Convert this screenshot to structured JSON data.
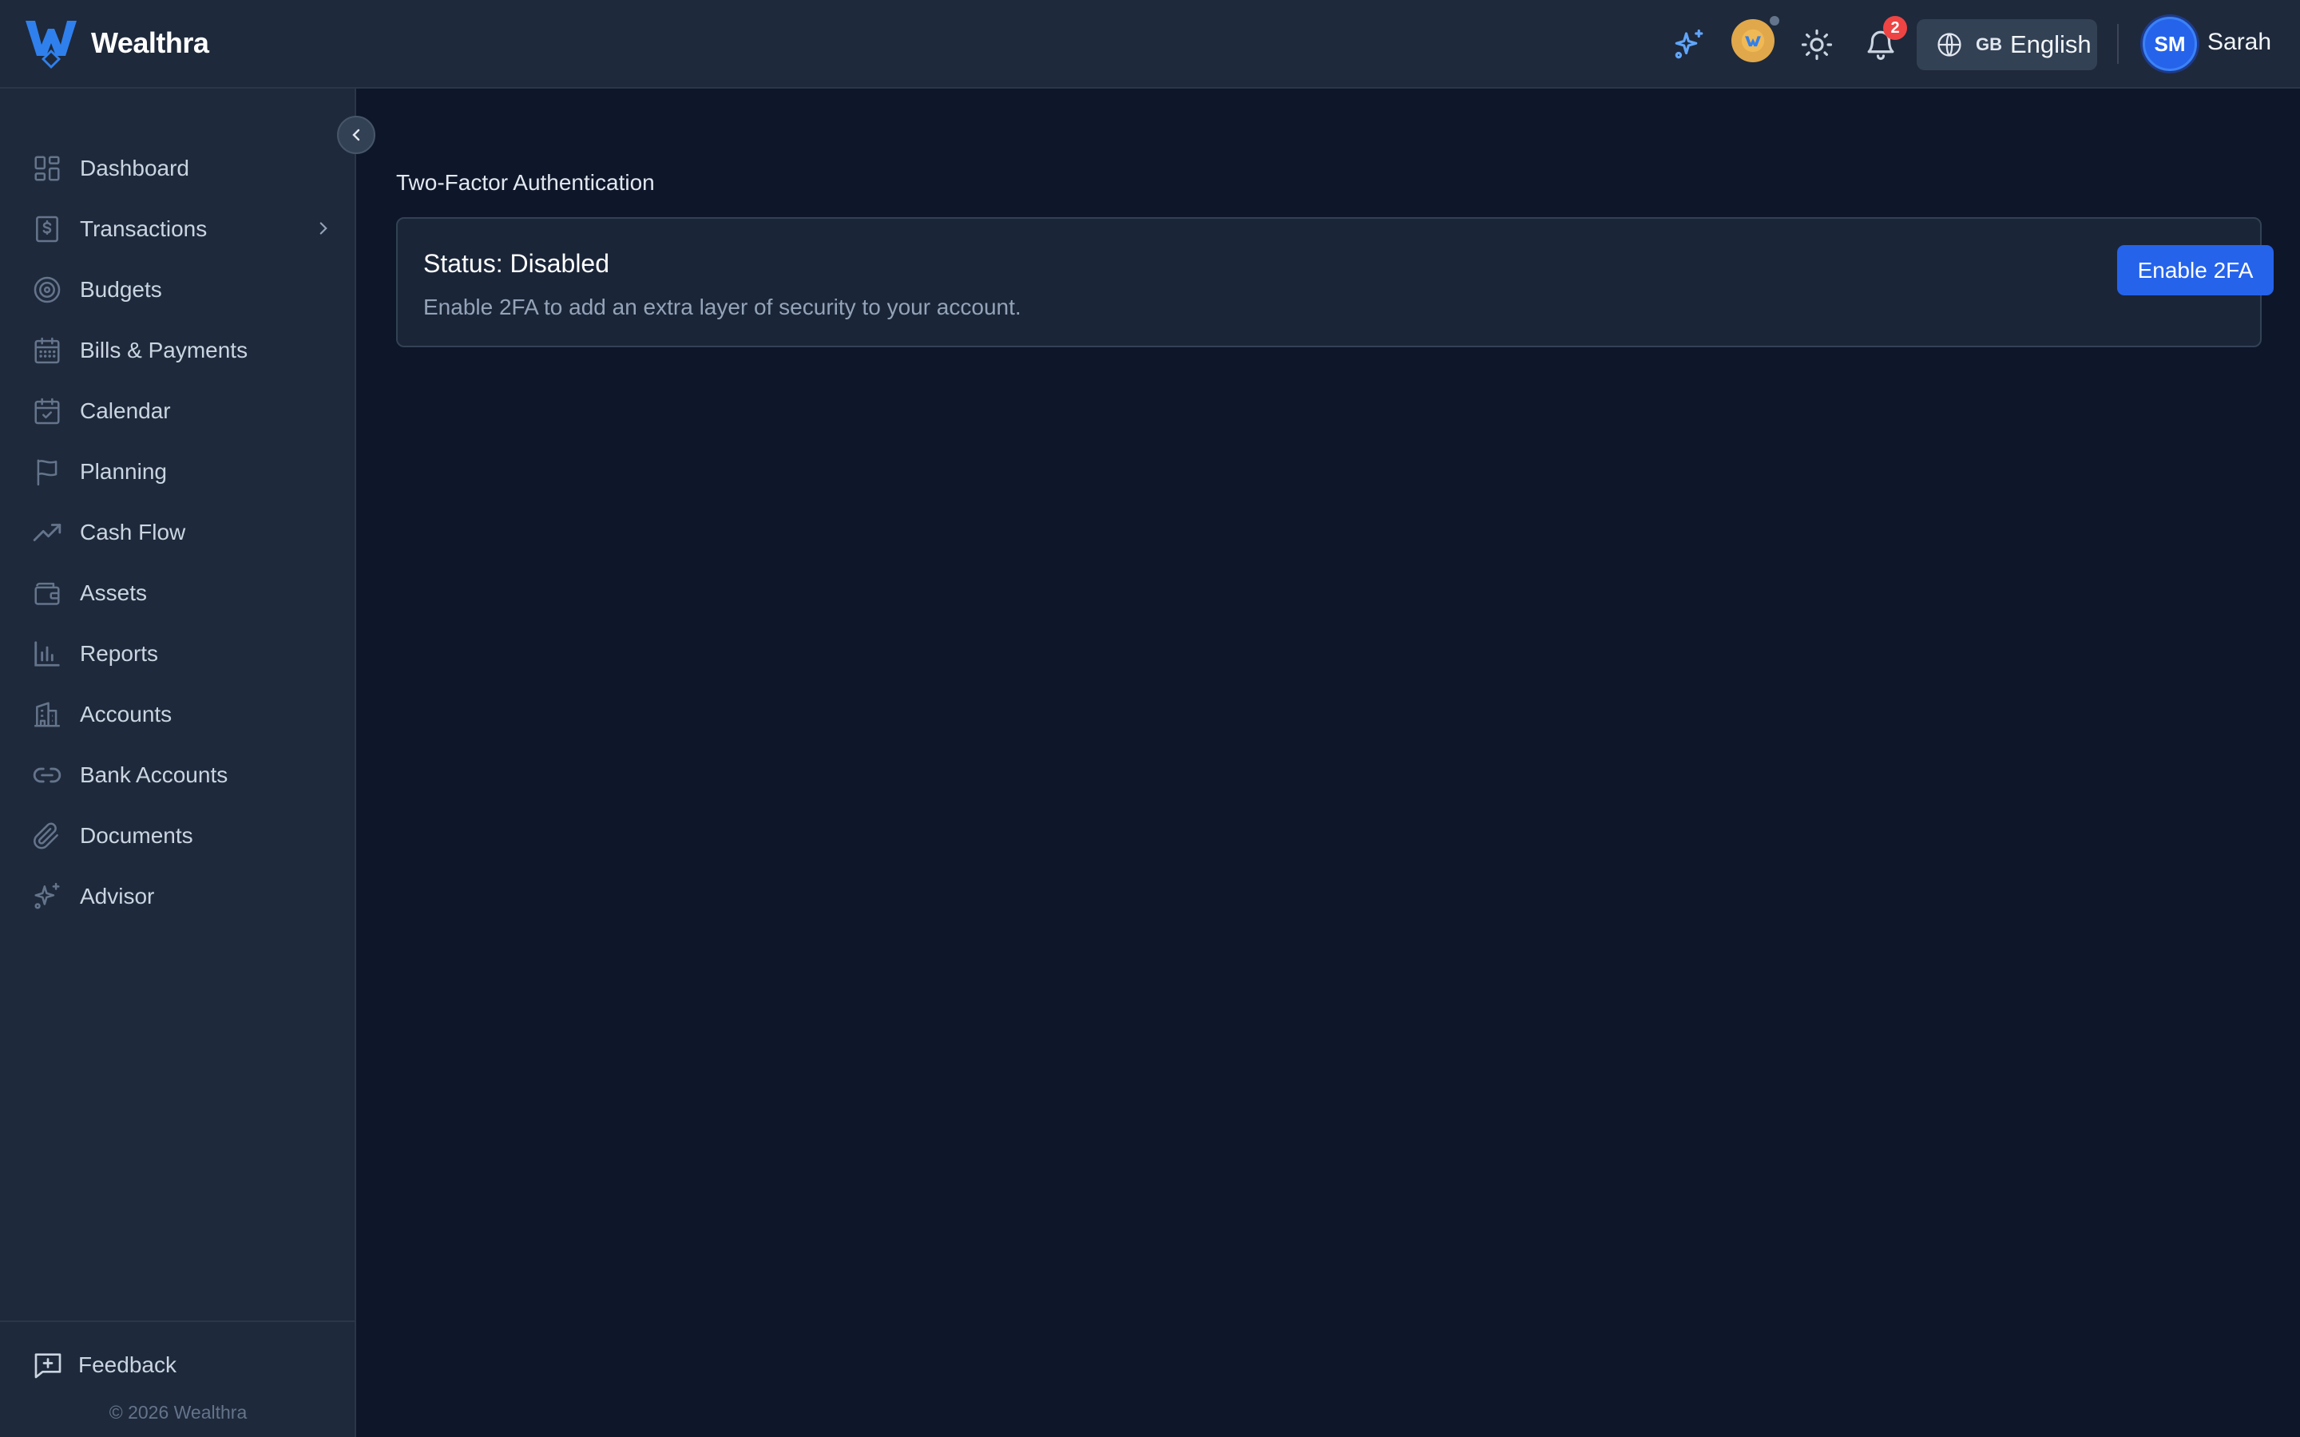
{
  "header": {
    "brand_name": "Wealthra",
    "language_flag": "GB",
    "language_label": "English",
    "notification_count": "2",
    "user_initials": "SM",
    "user_name": "Sarah",
    "icons": [
      "sparkles-icon",
      "coin-icon",
      "sun-icon",
      "bell-icon",
      "globe-icon"
    ]
  },
  "sidebar": {
    "items": [
      {
        "label": "Dashboard",
        "icon": "dashboard-icon"
      },
      {
        "label": "Transactions",
        "icon": "receipt-icon",
        "has_submenu": true
      },
      {
        "label": "Budgets",
        "icon": "target-icon"
      },
      {
        "label": "Bills & Payments",
        "icon": "calendar-grid-icon"
      },
      {
        "label": "Calendar",
        "icon": "calendar-check-icon"
      },
      {
        "label": "Planning",
        "icon": "flag-icon"
      },
      {
        "label": "Cash Flow",
        "icon": "trending-up-icon"
      },
      {
        "label": "Assets",
        "icon": "wallet-icon"
      },
      {
        "label": "Reports",
        "icon": "bar-chart-icon"
      },
      {
        "label": "Accounts",
        "icon": "building-icon"
      },
      {
        "label": "Bank Accounts",
        "icon": "link-icon"
      },
      {
        "label": "Documents",
        "icon": "paperclip-icon"
      },
      {
        "label": "Advisor",
        "icon": "sparkles-icon"
      }
    ],
    "feedback_label": "Feedback",
    "copyright": "© 2026 Wealthra"
  },
  "main": {
    "section_title": "Two-Factor Authentication",
    "status_text": "Status: Disabled",
    "description": "Enable 2FA to add an extra layer of security to your account.",
    "enable_button_label": "Enable 2FA"
  },
  "colors": {
    "background": "#0e1629",
    "panel": "#1e293b",
    "accent": "#2563eb",
    "badge": "#ef4444",
    "brand_blue": "#2f80ed"
  }
}
